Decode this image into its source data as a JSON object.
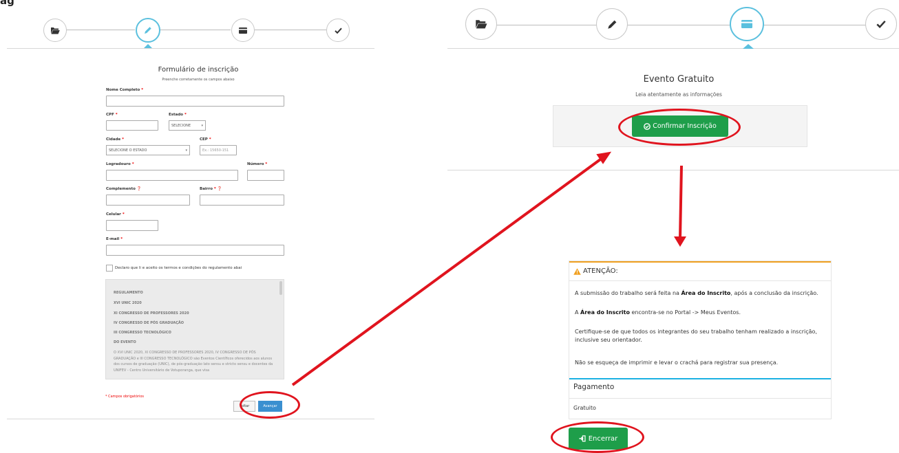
{
  "top_label": "ag",
  "left": {
    "form_title": "Formulário de inscrição",
    "form_subtitle": "Preenche corretamente os campos abaixo",
    "fields": {
      "nome": "Nome Completo",
      "cpf": "CPF",
      "estado": "Estado",
      "estado_value": "SELECIONE",
      "cidade": "Cidade",
      "cidade_value": "SELECIONE O ESTADO",
      "cep": "CEP",
      "cep_placeholder": "Ex.: 15650-151",
      "logradouro": "Logradouro",
      "numero": "Número",
      "complemento": "Complemento",
      "bairro": "Bairro",
      "celular": "Celular",
      "email": "E-mail"
    },
    "req_mark": "*",
    "terms": "Declaro que li e aceito os termos e condições do regulamento abai",
    "regulamento": {
      "lines": [
        "REGULAMENTO",
        "XVI UNIC 2020",
        "XI CONGRESSO DE PROFESSORES 2020",
        "IV CONGRESSO DE PÓS GRADUAÇÃO",
        "III CONGRESSO TECNOLÓGICO",
        "DO EVENTO"
      ],
      "body": "O XVI UNIC 2020, XI CONGRESSO DE PROFESSORES 2020, IV CONGRESSO DE PÓS GRADUAÇÃO e III CONGRESSO TECNOLÓGICO são Eventos Científicos oferecidos aos alunos dos cursos de graduação (UNIC), de pós-graduação lato sensu e stricto sensu e docentes da UNIFEV - Centro Universitário de Votuporanga, que visa"
    },
    "required_note": "* Campos obrigatórios",
    "btn_voltar": "Voltar",
    "btn_avancar": "Avançar"
  },
  "right": {
    "title": "Evento Gratuito",
    "subtitle": "Leia atentamente as informações",
    "btn_confirmar": "Confirmar Inscrição",
    "attention_title": "ATENÇÃO:",
    "p1_a": "A submissão do trabalho será feita na ",
    "p1_b": "Área do Inscrito",
    "p1_c": ", após a conclusão da inscrição.",
    "p2_a": "A ",
    "p2_b": "Área do Inscrito",
    "p2_c": " encontra-se no Portal -> Meus Eventos.",
    "p3_l1": "Certifique-se de que todos os integrantes do seu trabalho tenham realizado a inscrição,",
    "p3_l2": "inclusive seu orientador.",
    "p4": "Não se esqueça de imprimir e levar o crachá para registrar sua presença.",
    "payment_label": "Pagamento",
    "payment_value": "Gratuito",
    "btn_encerrar": "Encerrar"
  },
  "colors": {
    "accent_blue": "#5bc0de",
    "green": "#1e9e4a",
    "annotation_red": "#e0141e",
    "warning_orange": "#f0a020",
    "info_blue": "#1ab1e3"
  },
  "icons": {
    "step1": "folder-open-icon",
    "step2": "pencil-icon",
    "step3": "credit-card-icon",
    "step4": "check-icon"
  }
}
